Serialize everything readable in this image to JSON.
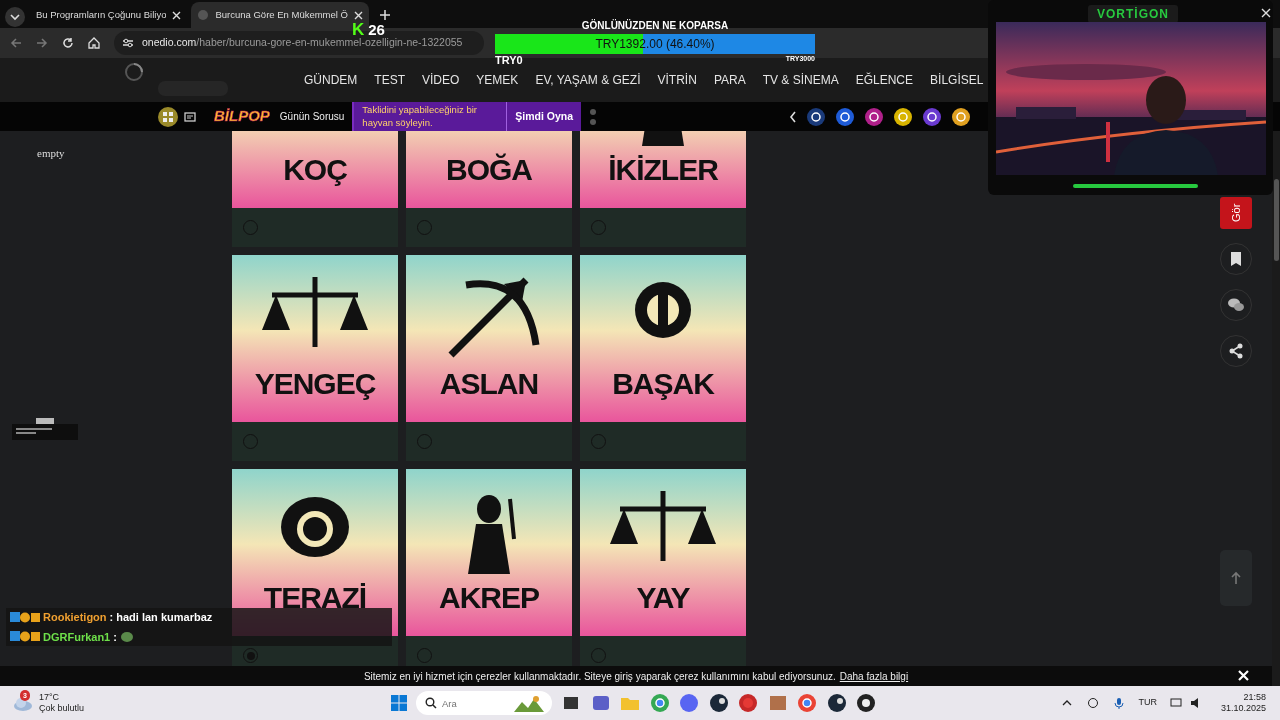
{
  "browser": {
    "tabs": [
      {
        "title": "Bu Programların Çoğunu Biliyo",
        "selected": false
      },
      {
        "title": "Burcuna Göre En Mükemmel Ö",
        "selected": true
      }
    ],
    "url_host": "onedio.com",
    "url_path": "/haber/burcuna-gore-en-mukemmel-ozelligin-ne-1322055"
  },
  "stream_overlay": {
    "platform_mark": "K",
    "viewer_count": "26",
    "goal": {
      "title": "GÖNLÜNÜZDEN NE KOPARSA",
      "amount": "TRY1392.00 (46.40%)",
      "level": 0.464,
      "min": "TRY0",
      "max": "TRY3000"
    }
  },
  "webcam": {
    "title": "VORTİGON",
    "kind": "picture"
  },
  "site_nav": {
    "items": [
      "GÜNDEM",
      "TEST",
      "VİDEO",
      "YEMEK",
      "EV, YAŞAM & GEZİ",
      "VİTRİN",
      "PARA",
      "TV & SİNEMA",
      "EĞLENCE",
      "BİLGİSEL"
    ]
  },
  "promo_bar": {
    "brand": "BİLPOP",
    "label": "Günün Sorusu",
    "question": "Taklidini yapabileceğiniz bir hayvan söyleyin.",
    "cta": "Şimdi Oyna"
  },
  "sidebar_text": "empty",
  "signs": [
    {
      "name": "KOÇ",
      "selected": false
    },
    {
      "name": "BOĞA",
      "selected": false
    },
    {
      "name": "İKİZLER",
      "selected": false
    },
    {
      "name": "YENGEÇ",
      "selected": false
    },
    {
      "name": "ASLAN",
      "selected": false
    },
    {
      "name": "BAŞAK",
      "selected": false
    },
    {
      "name": "TERAZİ",
      "selected": true
    },
    {
      "name": "AKREP",
      "selected": false
    },
    {
      "name": "YAY",
      "selected": false
    }
  ],
  "side_actions": {
    "view_button": "Gör"
  },
  "chat": [
    {
      "user": "Rookietigon",
      "message": ": hadi lan kumarbaz",
      "color": "#f0a030"
    },
    {
      "user": "DGRFurkan1",
      "message": ":",
      "color": "#6ee04a"
    }
  ],
  "cookie_bar": {
    "text": "Sitemiz en iyi hizmet için çerezler kullanmaktadır. Siteye giriş yaparak çerez kullanımını kabul ediyorsunuz.",
    "link": "Daha fazla bilgi"
  },
  "taskbar": {
    "weather_badge": "3",
    "temperature": "17°C",
    "condition": "Çok bulutlu",
    "search_placeholder": "Ara",
    "language": "TUR",
    "time": "21:58",
    "date": "31.10.2025"
  }
}
